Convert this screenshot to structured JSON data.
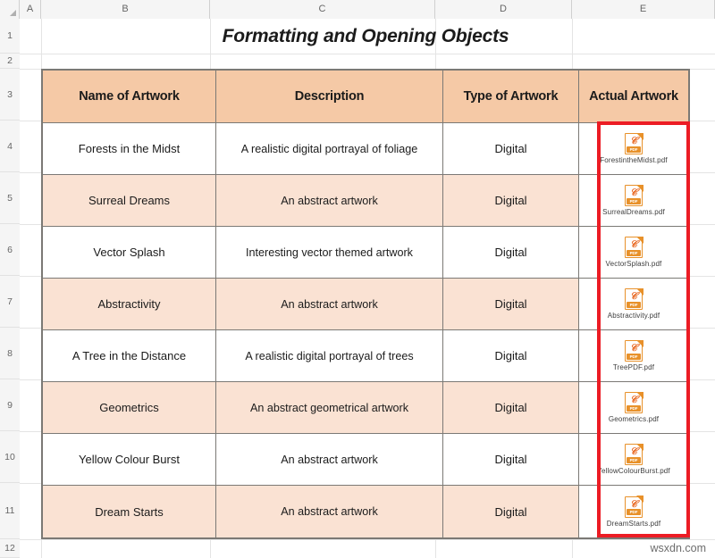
{
  "app": {
    "type": "spreadsheet",
    "watermark": "wsxdn.com"
  },
  "sheet": {
    "column_headers": [
      "A",
      "B",
      "C",
      "D",
      "E"
    ],
    "row_headers": [
      "1",
      "2",
      "3",
      "4",
      "5",
      "6",
      "7",
      "8",
      "9",
      "10",
      "11",
      "12"
    ]
  },
  "title": "Formatting and Opening Objects",
  "table": {
    "headers": {
      "name": "Name of Artwork",
      "description": "Description",
      "type": "Type of Artwork",
      "artwork": "Actual Artwork"
    },
    "colors": {
      "header_fill": "#F5C9A6",
      "row_alt_fill": "#FAE2D3",
      "row_fill": "#FFFFFF",
      "border": "#7B7975",
      "highlight": "#EC1C24",
      "pdf_icon": "#E8912A"
    },
    "rows": [
      {
        "name": "Forests in the Midst",
        "description": "A realistic digital portrayal of  foliage",
        "type": "Digital",
        "file": "ForestintheMidst.pdf",
        "icon": "pdf-file-icon",
        "shaded": false
      },
      {
        "name": "Surreal Dreams",
        "description": "An abstract artwork",
        "type": "Digital",
        "file": "SurrealDreams.pdf",
        "icon": "pdf-file-icon",
        "shaded": true
      },
      {
        "name": "Vector Splash",
        "description": "Interesting vector themed artwork",
        "type": "Digital",
        "file": "VectorSplash.pdf",
        "icon": "pdf-file-icon",
        "shaded": false
      },
      {
        "name": "Abstractivity",
        "description": "An abstract artwork",
        "type": "Digital",
        "file": "Abstractivity.pdf",
        "icon": "pdf-file-icon",
        "shaded": true
      },
      {
        "name": "A Tree in the Distance",
        "description": "A realistic digital portrayal of trees",
        "type": "Digital",
        "file": "TreePDF.pdf",
        "icon": "pdf-file-icon",
        "shaded": false
      },
      {
        "name": "Geometrics",
        "description": "An abstract geometrical artwork",
        "type": "Digital",
        "file": "Geometrics.pdf",
        "icon": "pdf-file-icon",
        "shaded": true
      },
      {
        "name": "Yellow Colour Burst",
        "description": "An abstract artwork",
        "type": "Digital",
        "file": "YellowColourBurst.pdf",
        "icon": "pdf-file-icon",
        "shaded": false
      },
      {
        "name": "Dream Starts",
        "description": "An abstract artwork",
        "type": "Digital",
        "file": "DreamStarts.pdf",
        "icon": "pdf-file-icon",
        "shaded": true
      }
    ],
    "pdf_icon_label": "PDF"
  }
}
